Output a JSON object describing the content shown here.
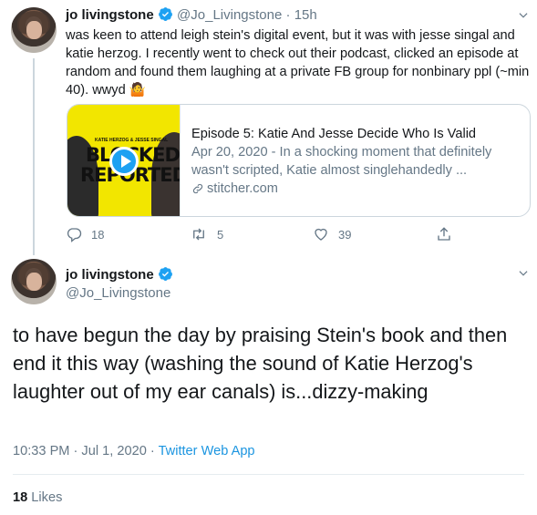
{
  "tweet1": {
    "name": "jo livingstone",
    "handle": "@Jo_Livingstone",
    "separator": "·",
    "time": "15h",
    "text": "was keen to attend leigh stein's digital event, but it was with jesse singal and katie herzog. I recently went to check out their podcast, clicked an episode at random and found them laughing at a private FB group for nonbinary ppl (~min 40). wwyd",
    "emoji": "🤷",
    "card": {
      "thumb_small_text": "KATIE HERZOG & JESSE SINGAL",
      "thumb_line1": "BLOCKED&",
      "thumb_line2": "REPORTED",
      "title": "Episode 5: Katie And Jesse Decide Who Is Valid",
      "description": "Apr 20, 2020 - In a shocking moment that definitely wasn't scripted, Katie almost singlehandedly ...",
      "domain": "stitcher.com"
    },
    "actions": {
      "replies": "18",
      "retweets": "5",
      "likes": "39"
    }
  },
  "tweet2": {
    "name": "jo livingstone",
    "handle": "@Jo_Livingstone",
    "text": "to have begun the day by praising Stein's book and then end it this way (washing the sound of Katie Herzog's laughter out of my ear canals) is...dizzy-making",
    "time": "10:33 PM · Jul 1, 2020",
    "meta_sep": " · ",
    "source": "Twitter Web App",
    "likes_count": "18",
    "likes_label": "Likes"
  },
  "colors": {
    "accent": "#1da1f2",
    "muted": "#657786",
    "text": "#14171a",
    "thumb_yellow": "#f2e600"
  },
  "icons": [
    "verified-badge-icon",
    "chevron-down-icon",
    "reply-icon",
    "retweet-icon",
    "like-icon",
    "share-icon",
    "link-icon",
    "play-icon"
  ]
}
